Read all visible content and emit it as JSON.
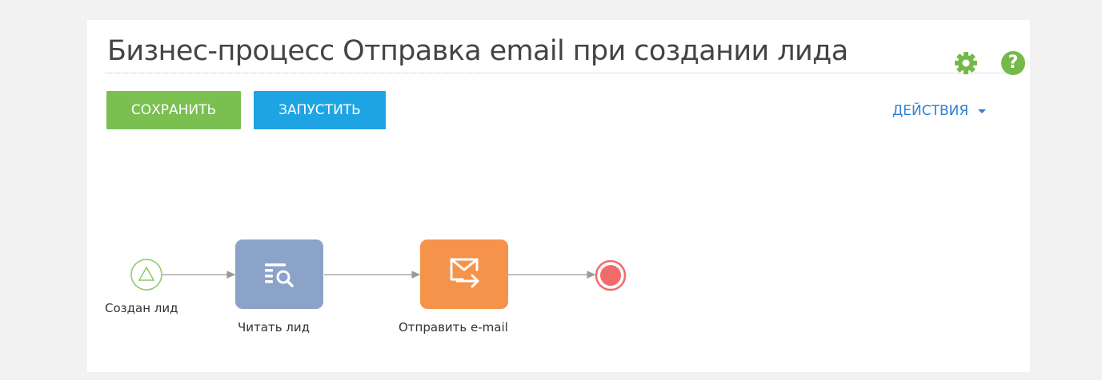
{
  "header": {
    "title": "Бизнес-процесс Отправка email при создании лида"
  },
  "toolbar": {
    "save_label": "СОХРАНИТЬ",
    "run_label": "ЗАПУСТИТЬ",
    "actions_label": "ДЕЙСТВИЯ"
  },
  "icons": {
    "settings": "gear-icon",
    "help": "question-icon",
    "help_glyph": "?"
  },
  "diagram": {
    "start_label": "Создан лид",
    "read_label": "Читать лид",
    "email_label": "Отправить e-mail"
  },
  "colors": {
    "save": "#7ac050",
    "run": "#1ea4e3",
    "read_task": "#8ba3c9",
    "email_task": "#f5934a",
    "end_event": "#f26b6b",
    "start_event": "#8cc867"
  }
}
